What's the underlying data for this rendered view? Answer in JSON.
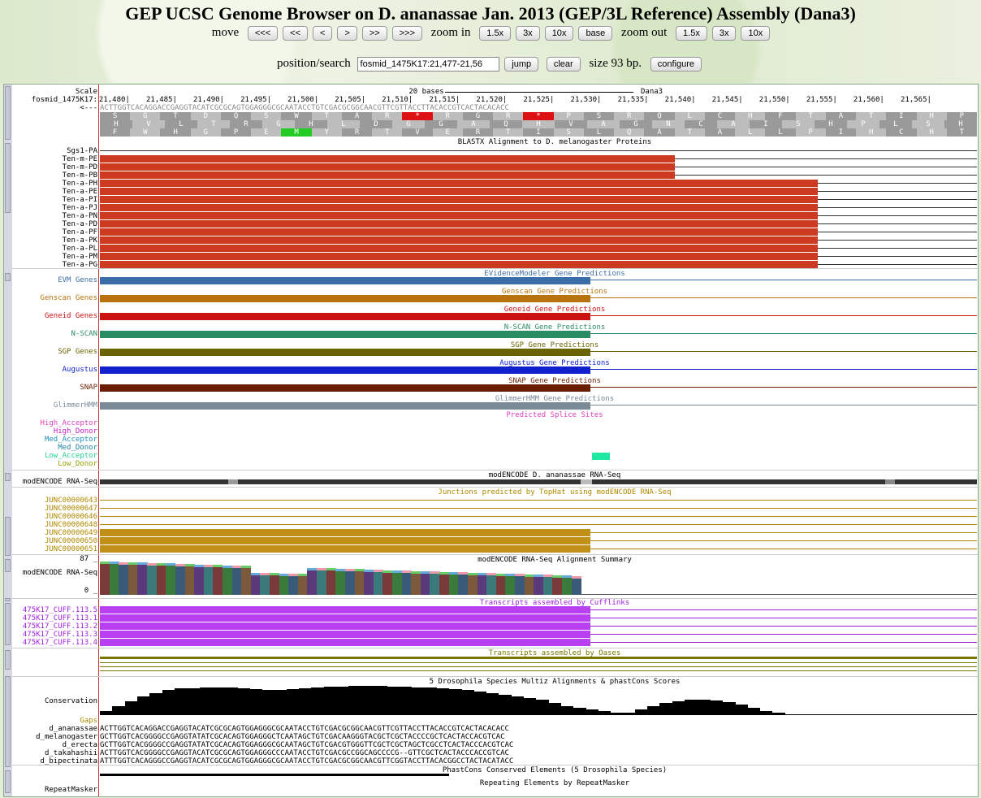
{
  "title": "GEP UCSC Genome Browser on D. ananassae Jan. 2013 (GEP/3L Reference) Assembly (Dana3)",
  "nav": {
    "move_label": "move",
    "move_buttons": [
      "<<<",
      "<<",
      "<",
      ">",
      ">>",
      ">>>"
    ],
    "zoom_in_label": "zoom in",
    "zoom_in_buttons": [
      "1.5x",
      "3x",
      "10x",
      "base"
    ],
    "zoom_out_label": "zoom out",
    "zoom_out_buttons": [
      "1.5x",
      "3x",
      "10x"
    ]
  },
  "search": {
    "label": "position/search",
    "value": "fosmid_1475K17:21,477-21,56",
    "jump": "jump",
    "clear": "clear",
    "size_text": "size 93 bp.",
    "configure": "configure"
  },
  "ruler": {
    "scale_label": "Scale",
    "chrom_label": "fosmid_1475K17:",
    "strand_label": "<---",
    "scale_text": "20 bases",
    "assembly": "Dana3",
    "ticks": [
      "21,480|",
      "21,485|",
      "21,490|",
      "21,495|",
      "21,500|",
      "21,505|",
      "21,510|",
      "21,515|",
      "21,520|",
      "21,525|",
      "21,530|",
      "21,535|",
      "21,540|",
      "21,545|",
      "21,550|",
      "21,555|",
      "21,560|",
      "21,565|"
    ],
    "sequence": "ACTTGGTCACAGGACCGAGGTACATCGCGCAGTGGAGGGCGCAATACCTGTCGACGCGGCAACGTTCGTTACCTTACACCGTCACTACACACC",
    "frame1": "SGTDQSWTAR*RGR*PSRQLCHFTATIHP",
    "frame2": "HVLTRGHLDGGAQHVAGNCAISHPLSH",
    "frame3": "FWHGPEMYRTVERTISLQATALLPIHCHT"
  },
  "tracks": {
    "blastx_title": "BLASTX Alignment to D. melanogaster Proteins",
    "blastx_items": [
      "Sgs1-PA",
      "Ten-m-PE",
      "Ten-m-PD",
      "Ten-m-PB",
      "Ten-a-PH",
      "Ten-a-PE",
      "Ten-a-PI",
      "Ten-a-PJ",
      "Ten-a-PN",
      "Ten-a-PD",
      "Ten-a-PF",
      "Ten-a-PK",
      "Ten-a-PL",
      "Ten-a-PM",
      "Ten-a-PG"
    ],
    "gene_tracks": [
      {
        "label": "EVM Genes",
        "title": "EVidenceModeler Gene Predictions",
        "color": "#3a6ea8"
      },
      {
        "label": "Genscan Genes",
        "title": "Genscan Gene Predictions",
        "color": "#b8730e"
      },
      {
        "label": "Geneid Genes",
        "title": "Geneid Gene Predictions",
        "color": "#cc1111"
      },
      {
        "label": "N-SCAN",
        "title": "N-SCAN Gene Predictions",
        "color": "#2a8c63"
      },
      {
        "label": "SGP Genes",
        "title": "SGP Gene Predictions",
        "color": "#6b6300"
      },
      {
        "label": "Augustus",
        "title": "Augustus Gene Predictions",
        "color": "#1020cc"
      },
      {
        "label": "SNAP",
        "title": "SNAP Gene Predictions",
        "color": "#6b1c00"
      },
      {
        "label": "GlimmerHMM",
        "title": "GlimmerHMM Gene Predictions",
        "color": "#7a8a96"
      }
    ],
    "splice_title": "Predicted Splice Sites",
    "splice_items": [
      {
        "label": "High_Acceptor",
        "color": "#e040c0"
      },
      {
        "label": "High_Donor",
        "color": "#c020c0"
      },
      {
        "label": "Med_Acceptor",
        "color": "#2090c0"
      },
      {
        "label": "Med_Donor",
        "color": "#2080a0"
      },
      {
        "label": "Low_Acceptor",
        "color": "#20d090"
      },
      {
        "label": "Low_Donor",
        "color": "#90a000"
      }
    ],
    "rnaseq_title": "modENCODE D. ananassae RNA-Seq",
    "rnaseq_label": "modENCODE RNA-Seq",
    "junc_title": "Junctions predicted by TopHat using modENCODE RNA-Seq",
    "junc_items": [
      "JUNC00000643",
      "JUNC00000647",
      "JUNC00000646",
      "JUNC00000648",
      "JUNC00000649",
      "JUNC00000650",
      "JUNC00000651"
    ],
    "summary_title": "modENCODE RNA-Seq Alignment Summary",
    "summary_label": "modENCODE RNA-Seq",
    "summary_max": "87 _",
    "summary_min": "0 _",
    "cuff_title": "Transcripts assembled by Cufflinks",
    "cuff_items": [
      "475K17_CUFF.113.5",
      "475K17_CUFF.113.1",
      "475K17_CUFF.113.2",
      "475K17_CUFF.113.3",
      "475K17_CUFF.113.4"
    ],
    "oases_title": "Transcripts assembled by Oases",
    "cons_title": "5 Drosophila Species Multiz Alignments & phastCons Scores",
    "cons_label": "Conservation",
    "gaps_label": "Gaps",
    "gap_nums": [
      "9",
      "6"
    ],
    "species": [
      {
        "name": "d_ananassae",
        "seq": "ACTTGGTCACAGGACCGAGGTACATCGCGCAGTGGAGGGCGCAATACCTGTCGACGCGGCAACGTTCGTTACCTTACACCGTCACTACACACC"
      },
      {
        "name": "d_melanogaster",
        "seq": "GCTTGGTCACGGGGCCGAGGTATATCGCACAGTGGAGGGCTCAATAGCTGTCGACAAGGGTACGCTCGCTACCCCGCTCACTACCACGTCAC"
      },
      {
        "name": "d_erecta",
        "seq": "GCTTGGTCACGGGGCCGAGGTATATCGCACAGTGGAGGGCGCAATAGCTGTCGACGTGGGTTCGCTCGCTAGCTCGCCTCACTACCCACGTCAC"
      },
      {
        "name": "d_takahashii",
        "seq": "ACTTGGTCACGGGGCCGAGGTACATCGCGCAGTGGAGGGCCCAATACCTGTCGACGCCGGCAGCCCCG--GTTCGCTCACTACCCACCGTCAC"
      },
      {
        "name": "d_bipectinata",
        "seq": "ATTTGGTCACAGGGCCGAGGTACATCGCGCAGTGGAGGGCGCAATACCTGTCGACGCGGCAACGTTCGGTACCTTACACGGCCTACTACATACC"
      }
    ],
    "phast_title": "PhastCons Conserved Elements (5 Drosophila Species)",
    "repeat_title": "Repeating Elements by RepeatMasker",
    "repeat_label": "RepeatMasker"
  }
}
